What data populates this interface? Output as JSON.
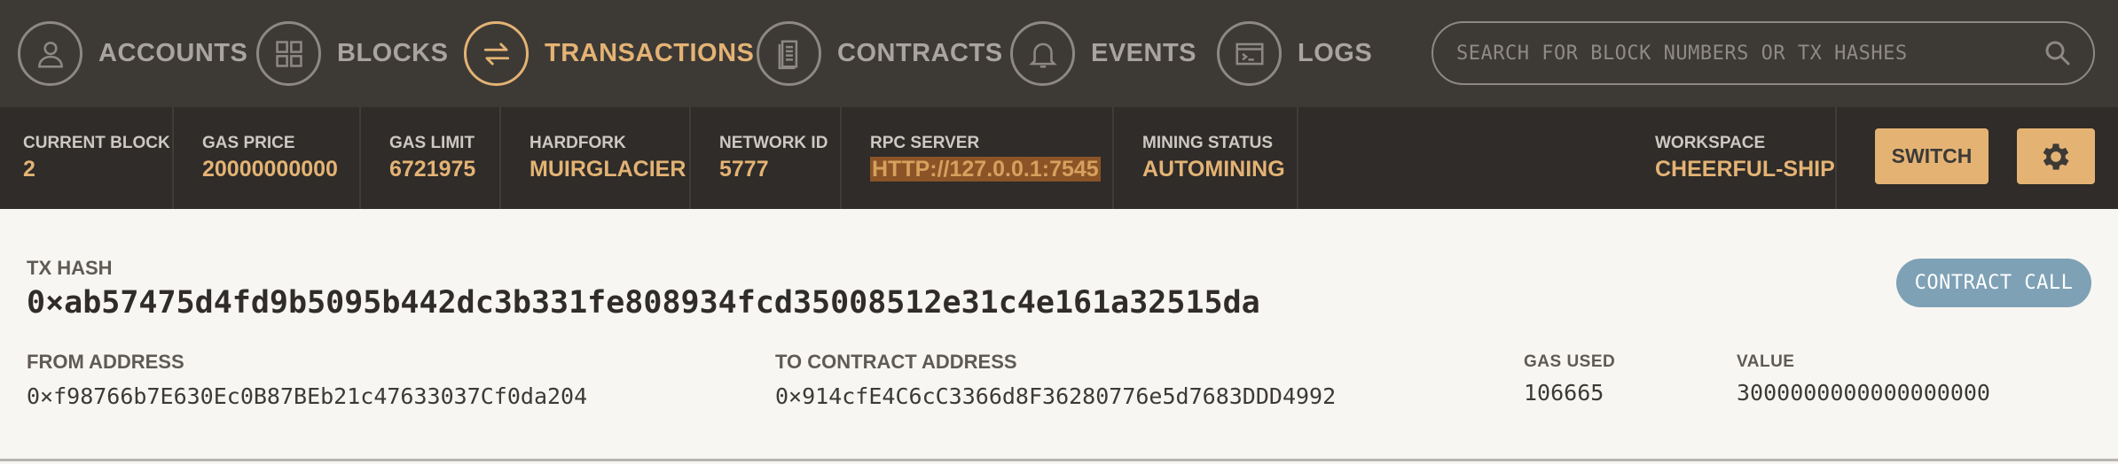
{
  "nav": {
    "items": [
      {
        "label": "ACCOUNTS",
        "icon": "user-icon",
        "active": false
      },
      {
        "label": "BLOCKS",
        "icon": "blocks-grid-icon",
        "active": false
      },
      {
        "label": "TRANSACTIONS",
        "icon": "arrows-exchange-icon",
        "active": true
      },
      {
        "label": "CONTRACTS",
        "icon": "document-icon",
        "active": false
      },
      {
        "label": "EVENTS",
        "icon": "bell-icon",
        "active": false
      },
      {
        "label": "LOGS",
        "icon": "terminal-icon",
        "active": false
      }
    ],
    "search_placeholder": "SEARCH FOR BLOCK NUMBERS OR TX HASHES"
  },
  "status": {
    "current_block_label": "CURRENT BLOCK",
    "current_block": "2",
    "gas_price_label": "GAS PRICE",
    "gas_price": "20000000000",
    "gas_limit_label": "GAS LIMIT",
    "gas_limit": "6721975",
    "hardfork_label": "HARDFORK",
    "hardfork": "MUIRGLACIER",
    "network_id_label": "NETWORK ID",
    "network_id": "5777",
    "rpc_server_label": "RPC SERVER",
    "rpc_server": "HTTP://127.0.0.1:7545",
    "mining_status_label": "MINING STATUS",
    "mining_status": "AUTOMINING",
    "workspace_label": "WORKSPACE",
    "workspace": "CHEERFUL-SHIP",
    "switch_label": "SWITCH"
  },
  "transaction": {
    "tx_hash_label": "TX HASH",
    "tx_hash": "0×ab57475d4fd9b5095b442dc3b331fe808934fcd35008512e31c4e161a32515da",
    "type_badge": "CONTRACT CALL",
    "from_label": "FROM ADDRESS",
    "from": "0×f98766b7E630Ec0B87BEb21c47633037Cf0da204",
    "to_label": "TO CONTRACT ADDRESS",
    "to": "0×914cfE4C6cC3366d8F36280776e5d7683DDD4992",
    "gas_used_label": "GAS USED",
    "gas_used": "106665",
    "value_label": "VALUE",
    "value": "3000000000000000000"
  },
  "colors": {
    "nav_bg": "#3d3a36",
    "status_bg": "#2f2c29",
    "accent": "#e4b374",
    "badge": "#7ea1b5"
  }
}
